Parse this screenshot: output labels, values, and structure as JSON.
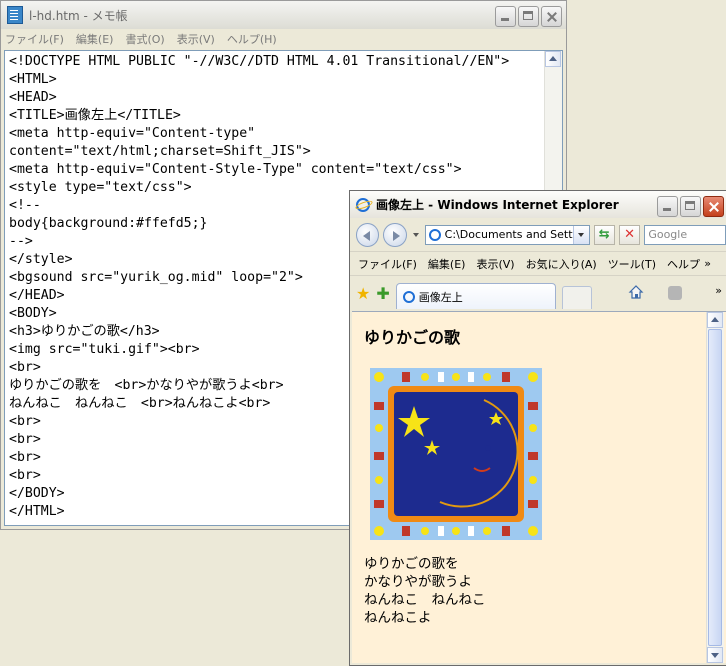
{
  "notepad": {
    "title": "l-hd.htm - メモ帳",
    "menu": [
      "ファイル(F)",
      "編集(E)",
      "書式(O)",
      "表示(V)",
      "ヘルプ(H)"
    ],
    "lines": [
      "<!DOCTYPE HTML PUBLIC \"-//W3C//DTD HTML 4.01 Transitional//EN\">",
      "<HTML>",
      "<HEAD>",
      "<TITLE>画像左上</TITLE>",
      "<meta http-equiv=\"Content-type\"",
      "content=\"text/html;charset=Shift_JIS\">",
      "<meta http-equiv=\"Content-Style-Type\" content=\"text/css\">",
      "<style type=\"text/css\">",
      "<!--",
      "body{background:#ffefd5;}",
      "-->",
      "</style>",
      "<bgsound src=\"yurik_og.mid\" loop=\"2\">",
      "</HEAD>",
      "<BODY>",
      "<h3>ゆりかごの歌</h3>",
      "<img src=\"tuki.gif\"><br>",
      "<br>",
      "ゆりかごの歌を　<br>かなりやが歌うよ<br>",
      "ねんねこ　ねんねこ　<br>ねんねこよ<br>",
      "<br>",
      "<br>",
      "<br>",
      "<br>",
      "</BODY>",
      "</HTML>"
    ]
  },
  "ie": {
    "title": "画像左上 - Windows Internet Explorer",
    "address": "C:\\Documents and Settings",
    "search_placeholder": "Google",
    "menu": [
      "ファイル(F)",
      "編集(E)",
      "表示(V)",
      "お気に入り(A)",
      "ツール(T)",
      "ヘルプ"
    ],
    "tab_label": "画像左上",
    "heading": "ゆりかごの歌",
    "lyrics": [
      "ゆりかごの歌を",
      "かなりやが歌うよ",
      "ねんねこ　ねんねこ",
      "ねんねこよ"
    ],
    "page_background": "#fff1d7"
  }
}
